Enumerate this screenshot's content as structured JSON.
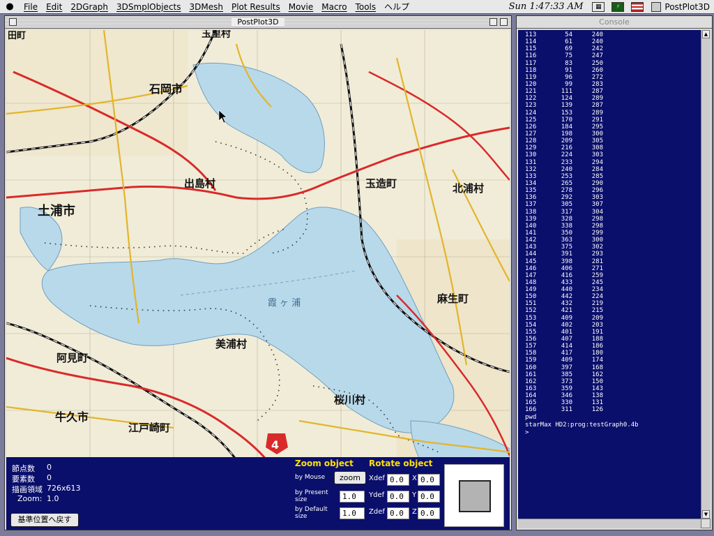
{
  "menubar": {
    "apple_icon": "apple-logo",
    "items": [
      "File",
      "Edit",
      "2DGraph",
      "3DSmplObjects",
      "3DMesh",
      "Plot Results",
      "Movie",
      "Macro",
      "Tools",
      "ヘルプ"
    ],
    "clock": "Sun 1:47:33 AM",
    "app_name": "PostPlot3D"
  },
  "postplot": {
    "title": "PostPlot3D",
    "map": {
      "lake_label": "霞 ヶ 浦",
      "place_labels": [
        "石岡市",
        "出島村",
        "土浦市",
        "玉造町",
        "北浦村",
        "麻生町",
        "美浦村",
        "阿見町",
        "桜川村",
        "牛久市",
        "江戸崎町",
        "玉里村",
        "田町"
      ],
      "badge": "4"
    },
    "info": {
      "nodes_label": "節点数",
      "nodes_value": "0",
      "elements_label": "要素数",
      "elements_value": "0",
      "area_label": "描画領域",
      "area_value": "726x613",
      "zoom_label": "Zoom:",
      "zoom_value": "1.0",
      "reset_button": "基準位置へ戻す"
    },
    "zoom_object": {
      "title": "Zoom object",
      "by_mouse": "by Mouse",
      "zoom_button": "zoom",
      "by_present_size": "by Present size",
      "present_value": "1.0",
      "by_default_size": "by Default size",
      "default_value": "1.0"
    },
    "rotate_object": {
      "title": "Rotate object",
      "xdef_label": "Xdef",
      "xdef_value": "0.0",
      "x_label": "X",
      "x_value": "0.0",
      "ydef_label": "Ydef",
      "ydef_value": "0.0",
      "y_label": "Y",
      "y_value": "0.0",
      "zdef_label": "Zdef",
      "zdef_value": "0.0",
      "z_label": "Z",
      "z_value": "0.0"
    }
  },
  "console": {
    "title": "Console",
    "rows": [
      [
        "113",
        "54",
        "240"
      ],
      [
        "114",
        "61",
        "240"
      ],
      [
        "115",
        "69",
        "242"
      ],
      [
        "116",
        "75",
        "247"
      ],
      [
        "117",
        "83",
        "250"
      ],
      [
        "118",
        "91",
        "260"
      ],
      [
        "119",
        "96",
        "272"
      ],
      [
        "120",
        "99",
        "283"
      ],
      [
        "121",
        "111",
        "287"
      ],
      [
        "122",
        "124",
        "289"
      ],
      [
        "123",
        "139",
        "287"
      ],
      [
        "124",
        "153",
        "289"
      ],
      [
        "125",
        "170",
        "291"
      ],
      [
        "126",
        "184",
        "295"
      ],
      [
        "127",
        "198",
        "300"
      ],
      [
        "128",
        "209",
        "305"
      ],
      [
        "129",
        "216",
        "308"
      ],
      [
        "130",
        "224",
        "303"
      ],
      [
        "131",
        "233",
        "294"
      ],
      [
        "132",
        "240",
        "284"
      ],
      [
        "133",
        "253",
        "285"
      ],
      [
        "134",
        "265",
        "290"
      ],
      [
        "135",
        "278",
        "296"
      ],
      [
        "136",
        "292",
        "303"
      ],
      [
        "137",
        "305",
        "307"
      ],
      [
        "138",
        "317",
        "304"
      ],
      [
        "139",
        "328",
        "298"
      ],
      [
        "140",
        "338",
        "298"
      ],
      [
        "141",
        "350",
        "299"
      ],
      [
        "142",
        "363",
        "300"
      ],
      [
        "143",
        "375",
        "302"
      ],
      [
        "144",
        "391",
        "293"
      ],
      [
        "145",
        "398",
        "281"
      ],
      [
        "146",
        "406",
        "271"
      ],
      [
        "147",
        "416",
        "259"
      ],
      [
        "148",
        "433",
        "245"
      ],
      [
        "149",
        "440",
        "234"
      ],
      [
        "150",
        "442",
        "224"
      ],
      [
        "151",
        "432",
        "219"
      ],
      [
        "152",
        "421",
        "215"
      ],
      [
        "153",
        "409",
        "209"
      ],
      [
        "154",
        "402",
        "203"
      ],
      [
        "155",
        "401",
        "191"
      ],
      [
        "156",
        "407",
        "188"
      ],
      [
        "157",
        "414",
        "186"
      ],
      [
        "158",
        "417",
        "180"
      ],
      [
        "159",
        "409",
        "174"
      ],
      [
        "160",
        "397",
        "168"
      ],
      [
        "161",
        "385",
        "162"
      ],
      [
        "162",
        "373",
        "150"
      ],
      [
        "163",
        "359",
        "143"
      ],
      [
        "164",
        "346",
        "138"
      ],
      [
        "165",
        "330",
        "131"
      ],
      [
        "166",
        "311",
        "126"
      ]
    ],
    "pwd": "pwd",
    "path": "starMax HD2:prog:testGraph0.4b",
    "prompt": ">"
  }
}
